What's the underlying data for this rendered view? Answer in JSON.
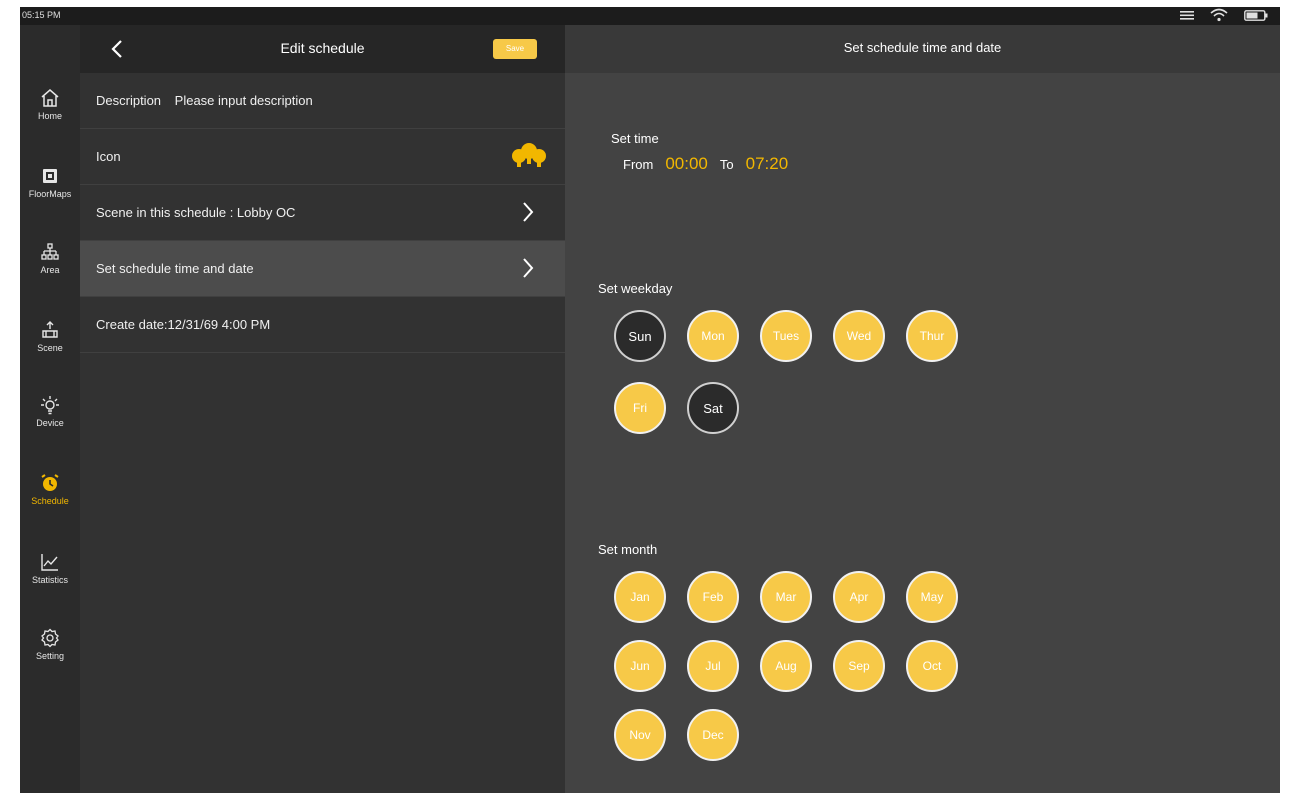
{
  "status_bar": {
    "time": "05:15 PM"
  },
  "sidebar": {
    "items": [
      {
        "label": "Home",
        "icon": "home-icon",
        "active": false
      },
      {
        "label": "FloorMaps",
        "icon": "floormap-icon",
        "active": false
      },
      {
        "label": "Area",
        "icon": "area-icon",
        "active": false
      },
      {
        "label": "Scene",
        "icon": "scene-icon",
        "active": false
      },
      {
        "label": "Device",
        "icon": "bulb-icon",
        "active": false
      },
      {
        "label": "Schedule",
        "icon": "alarm-clock-icon",
        "active": true
      },
      {
        "label": "Statistics",
        "icon": "chart-icon",
        "active": false
      },
      {
        "label": "Setting",
        "icon": "gear-icon",
        "active": false
      }
    ]
  },
  "left_panel": {
    "title": "Edit schedule",
    "save_label": "Save",
    "description_label": "Description",
    "description_placeholder": "Please input description",
    "icon_label": "Icon",
    "scene_row": "Scene in this schedule : Lobby OC",
    "time_date_row": "Set schedule time and date",
    "create_date": "Create date:12/31/69 4:00 PM"
  },
  "right_panel": {
    "title": "Set schedule time and date",
    "set_time_label": "Set time",
    "from_label": "From",
    "from_time": "00:00",
    "to_label": "To",
    "to_time": "07:20",
    "set_weekday_label": "Set weekday",
    "weekdays": [
      {
        "label": "Sun",
        "selected": false
      },
      {
        "label": "Mon",
        "selected": true
      },
      {
        "label": "Tues",
        "selected": true
      },
      {
        "label": "Wed",
        "selected": true
      },
      {
        "label": "Thur",
        "selected": true
      },
      {
        "label": "Fri",
        "selected": true
      },
      {
        "label": "Sat",
        "selected": false
      }
    ],
    "set_month_label": "Set month",
    "months": [
      {
        "label": "Jan",
        "selected": true
      },
      {
        "label": "Feb",
        "selected": true
      },
      {
        "label": "Mar",
        "selected": true
      },
      {
        "label": "Apr",
        "selected": true
      },
      {
        "label": "May",
        "selected": true
      },
      {
        "label": "Jun",
        "selected": true
      },
      {
        "label": "Jul",
        "selected": true
      },
      {
        "label": "Aug",
        "selected": true
      },
      {
        "label": "Sep",
        "selected": true
      },
      {
        "label": "Oct",
        "selected": true
      },
      {
        "label": "Nov",
        "selected": true
      },
      {
        "label": "Dec",
        "selected": true
      }
    ]
  },
  "colors": {
    "accent": "#f7c948",
    "highlight_text": "#f2b700"
  }
}
